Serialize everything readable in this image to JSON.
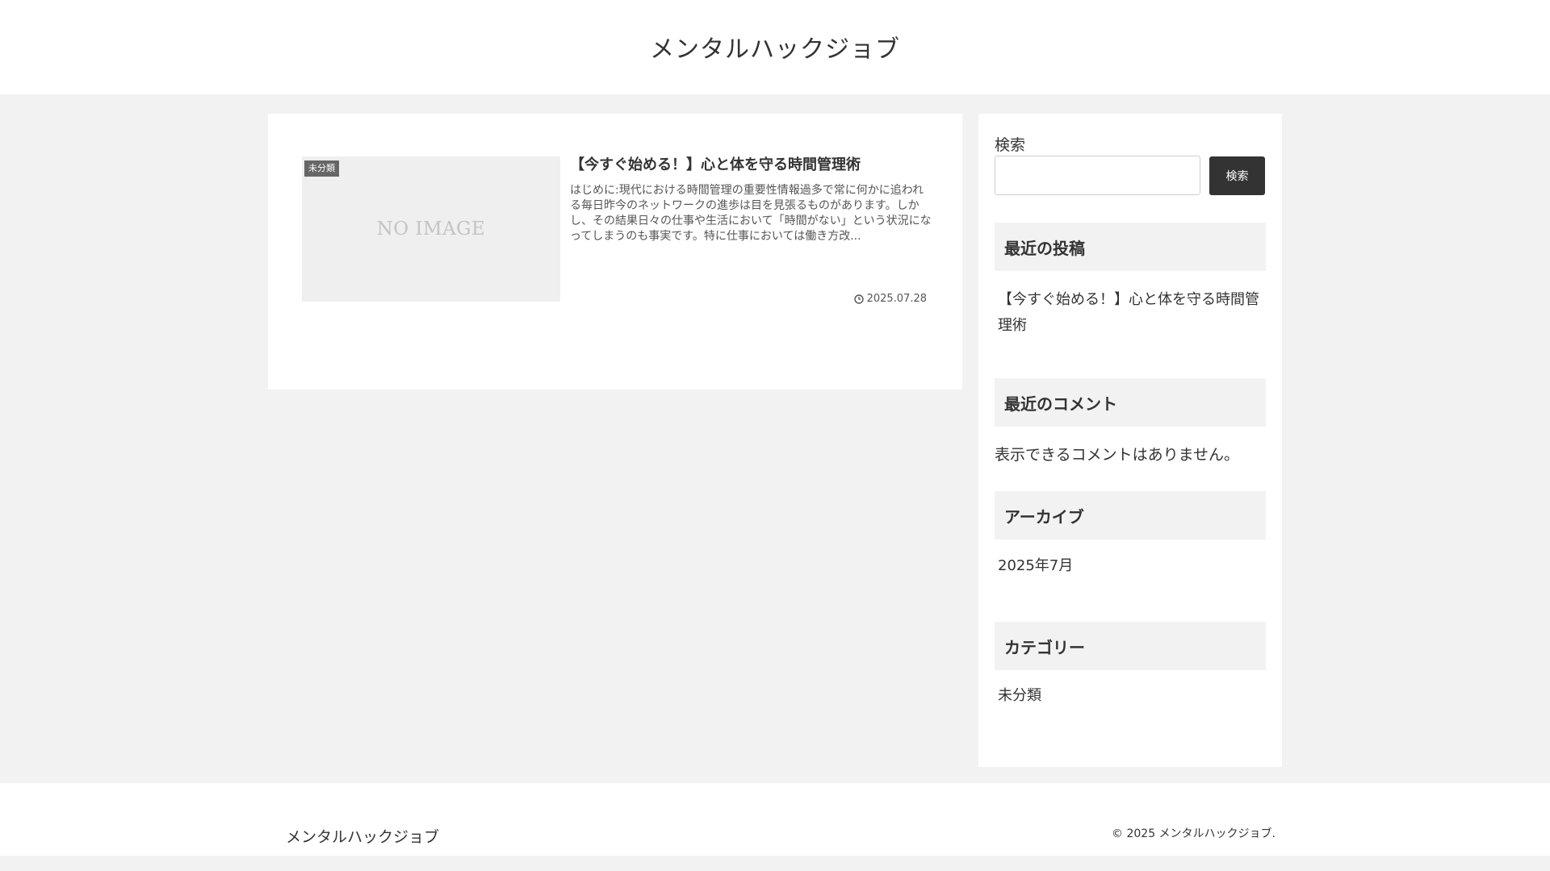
{
  "header": {
    "site_title": "メンタルハックジョブ"
  },
  "main": {
    "posts": [
      {
        "category": "未分類",
        "thumbnail_text": "NO IMAGE",
        "title": "【今すぐ始める！】心と体を守る時間管理術",
        "snippet": "はじめに:現代における時間管理の重要性情報過多で常に何かに追われる毎日昨今のネットワークの進歩は目を見張るものがあります。しかし、その結果日々の仕事や生活において「時間がない」という状況になってしまうのも事実です。特に仕事においては働き方改...",
        "date": "2025.07.28"
      }
    ]
  },
  "sidebar": {
    "search": {
      "label": "検索",
      "placeholder": "",
      "button_label": "検索"
    },
    "recent_posts": {
      "heading": "最近の投稿",
      "items": [
        "【今すぐ始める！】心と体を守る時間管理術"
      ]
    },
    "recent_comments": {
      "heading": "最近のコメント",
      "empty_text": "表示できるコメントはありません。"
    },
    "archives": {
      "heading": "アーカイブ",
      "items": [
        "2025年7月"
      ]
    },
    "categories": {
      "heading": "カテゴリー",
      "items": [
        "未分類"
      ]
    }
  },
  "footer": {
    "site_title": "メンタルハックジョブ",
    "copyright": "© 2025 メンタルハックジョブ."
  },
  "colors": {
    "page_background": "#f2f2f2",
    "card_background": "#ffffff",
    "button_background": "#333333",
    "category_label_background": "#666666"
  }
}
